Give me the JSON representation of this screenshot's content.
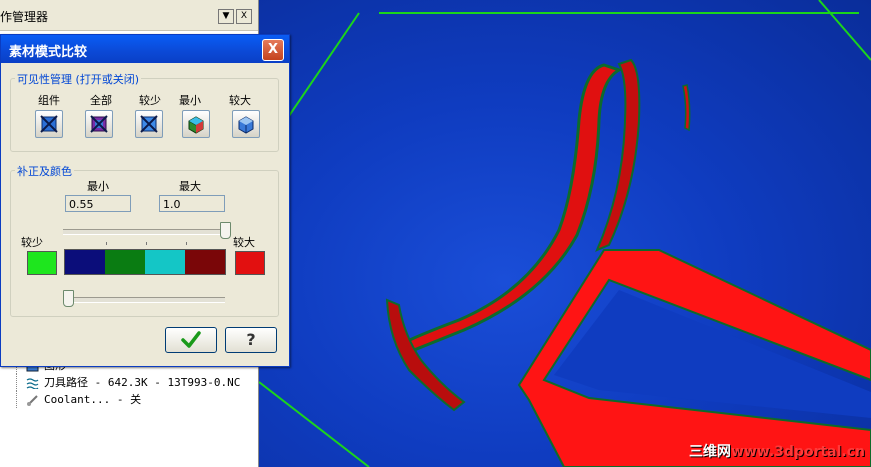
{
  "left_panel": {
    "title": "作管理器",
    "pin_label": "▼",
    "close_label": "X",
    "tree": [
      {
        "label": "图形 -"
      },
      {
        "label": "刀具路径 - 642.3K - 13T993-0.NC"
      },
      {
        "label": "Coolant... - 关"
      }
    ]
  },
  "dialog": {
    "title": "素材模式比较",
    "close_label": "X",
    "visibility": {
      "label": "可见性管理 (打开或关闭)",
      "buttons": [
        {
          "label": "组件",
          "icon": "component-icon"
        },
        {
          "label": "全部",
          "icon": "all-icon"
        },
        {
          "label": "较少",
          "icon": "less-icon"
        },
        {
          "label": "最小",
          "icon": "min-cube-icon"
        },
        {
          "label": "较大",
          "icon": "larger-cube-icon"
        }
      ]
    },
    "correction": {
      "label": "补正及颜色",
      "min_label": "最小",
      "max_label": "最大",
      "min_value": "0.55",
      "max_value": "1.0",
      "less_label": "较少",
      "more_label": "较大",
      "less_color": "#1ee61e",
      "more_color": "#e21010",
      "bands": [
        "#0b0d7a",
        "#0a7c12",
        "#14c6c6",
        "#7a0608"
      ],
      "top_slider_fraction": 1.0,
      "bottom_slider_fraction": 0.0
    },
    "ok_icon": "checkmark-icon",
    "help_label": "?"
  },
  "watermark": {
    "cn": "三维网",
    "url": "www.3dportal.cn"
  }
}
